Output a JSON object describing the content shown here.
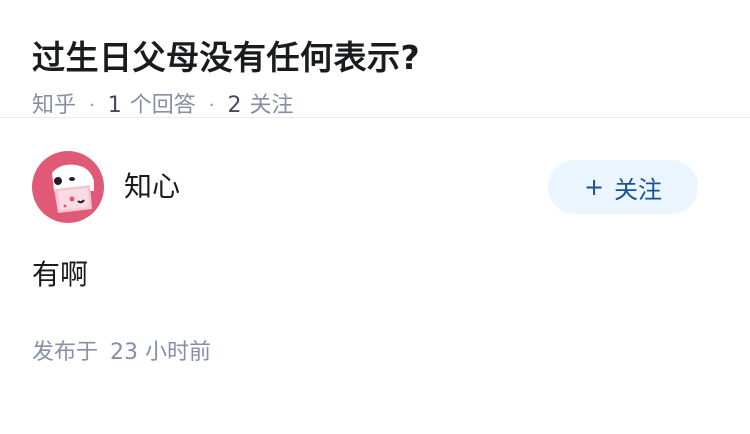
{
  "question": {
    "title": "过生日父母没有任何表示?",
    "source": "知乎",
    "answers_count": "1",
    "answers_label": "个回答",
    "followers_count": "2",
    "followers_label": "关注"
  },
  "answer": {
    "author_name": "知心",
    "follow_button_label": "关注",
    "follow_button_icon": "plus-icon",
    "content": "有啊",
    "published_prefix": "发布于",
    "published_value": "23 小时前"
  },
  "colors": {
    "title": "#191b1f",
    "meta_gray": "#8590a6",
    "follow_bg": "#ebf5ff",
    "follow_text": "#175199",
    "avatar_bg": "#e05a78"
  }
}
